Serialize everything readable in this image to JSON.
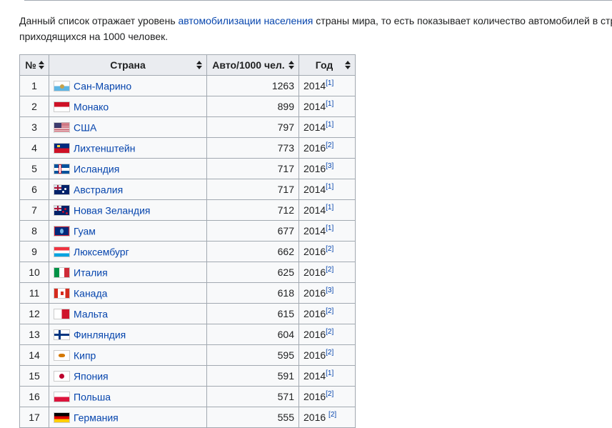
{
  "intro": {
    "part1": "Данный список отражает уровень ",
    "link": "автомобилизации населения",
    "part2": " страны мира, то есть показывает количество автомобилей в стра",
    "line2": "приходящихся на 1000 человек."
  },
  "table": {
    "headers": {
      "num": "№",
      "country": "Страна",
      "auto": "Авто/1000 чел.",
      "year": "Год"
    },
    "rows": [
      {
        "num": "1",
        "flag": "f-sanmarino",
        "country": "Сан-Марино",
        "auto": "1263",
        "year": "2014",
        "ref": "[1]"
      },
      {
        "num": "2",
        "flag": "f-monaco",
        "country": "Монако",
        "auto": "899",
        "year": "2014",
        "ref": "[1]"
      },
      {
        "num": "3",
        "flag": "f-usa",
        "country": "США",
        "auto": "797",
        "year": "2014",
        "ref": "[1]"
      },
      {
        "num": "4",
        "flag": "f-liecht",
        "country": "Лихтенштейн",
        "auto": "773",
        "year": "2016",
        "ref": "[2]"
      },
      {
        "num": "5",
        "flag": "f-iceland",
        "country": "Исландия",
        "auto": "717",
        "year": "2016",
        "ref": "[3]"
      },
      {
        "num": "6",
        "flag": "f-australia",
        "country": "Австралия",
        "auto": "717",
        "year": "2014",
        "ref": "[1]"
      },
      {
        "num": "7",
        "flag": "f-nz",
        "country": "Новая Зеландия",
        "auto": "712",
        "year": "2014",
        "ref": "[1]"
      },
      {
        "num": "8",
        "flag": "f-guam",
        "country": "Гуам",
        "auto": "677",
        "year": "2014",
        "ref": "[1]"
      },
      {
        "num": "9",
        "flag": "f-lux",
        "country": "Люксембург",
        "auto": "662",
        "year": "2016",
        "ref": "[2]"
      },
      {
        "num": "10",
        "flag": "f-italy",
        "country": "Италия",
        "auto": "625",
        "year": "2016",
        "ref": "[2]"
      },
      {
        "num": "11",
        "flag": "f-canada",
        "country": "Канада",
        "auto": "618",
        "year": "2016",
        "ref": "[3]"
      },
      {
        "num": "12",
        "flag": "f-malta",
        "country": "Мальта",
        "auto": "615",
        "year": "2016",
        "ref": "[2]"
      },
      {
        "num": "13",
        "flag": "f-finland",
        "country": "Финляндия",
        "auto": "604",
        "year": "2016",
        "ref": "[2]"
      },
      {
        "num": "14",
        "flag": "f-cyprus",
        "country": "Кипр",
        "auto": "595",
        "year": "2016",
        "ref": "[2]"
      },
      {
        "num": "15",
        "flag": "f-japan",
        "country": "Япония",
        "auto": "591",
        "year": "2014",
        "ref": "[1]"
      },
      {
        "num": "16",
        "flag": "f-poland",
        "country": "Польша",
        "auto": "571",
        "year": "2016",
        "ref": "[2]"
      },
      {
        "num": "17",
        "flag": "f-germany",
        "country": "Германия",
        "auto": "555",
        "year": "2016 ",
        "ref": "[2]"
      }
    ]
  }
}
